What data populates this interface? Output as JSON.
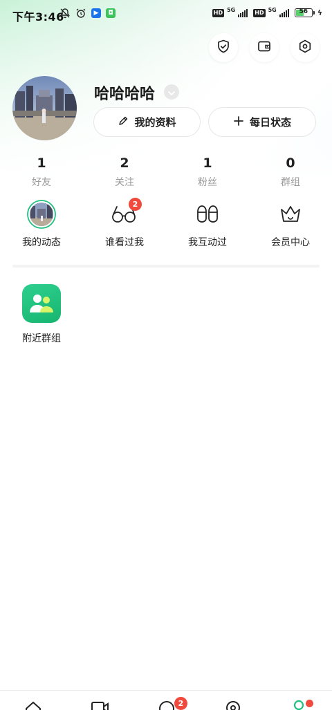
{
  "status_bar": {
    "time": "下午3:46",
    "network_1": "5G",
    "network_2": "5G",
    "hd_label": "HD",
    "battery_level": "56",
    "battery_percent": 56
  },
  "top_actions": {
    "icons": [
      "shield-check-icon",
      "wallet-icon",
      "settings-hexagon-icon"
    ]
  },
  "profile": {
    "username": "哈哈哈哈",
    "edit_profile_label": "我的资料",
    "daily_status_label": "每日状态"
  },
  "stats": [
    {
      "value": "1",
      "label": "好友"
    },
    {
      "value": "2",
      "label": "关注"
    },
    {
      "value": "1",
      "label": "粉丝"
    },
    {
      "value": "0",
      "label": "群组"
    }
  ],
  "quick_entries": [
    {
      "label": "我的动态",
      "icon": "avatar-ring-icon"
    },
    {
      "label": "谁看过我",
      "icon": "glasses-icon",
      "badge": "2"
    },
    {
      "label": "我互动过",
      "icon": "slippers-icon"
    },
    {
      "label": "会员中心",
      "icon": "crown-icon"
    }
  ],
  "groups": {
    "nearby_label": "附近群组"
  },
  "bottom_nav": {
    "message_badge": "2",
    "items": [
      "home-icon",
      "video-icon",
      "message-icon",
      "discover-icon",
      "profile-icon"
    ]
  },
  "colors": {
    "accent_green": "#1fc080",
    "badge_red": "#f04a3e",
    "muted_text": "#9a9a9a"
  }
}
